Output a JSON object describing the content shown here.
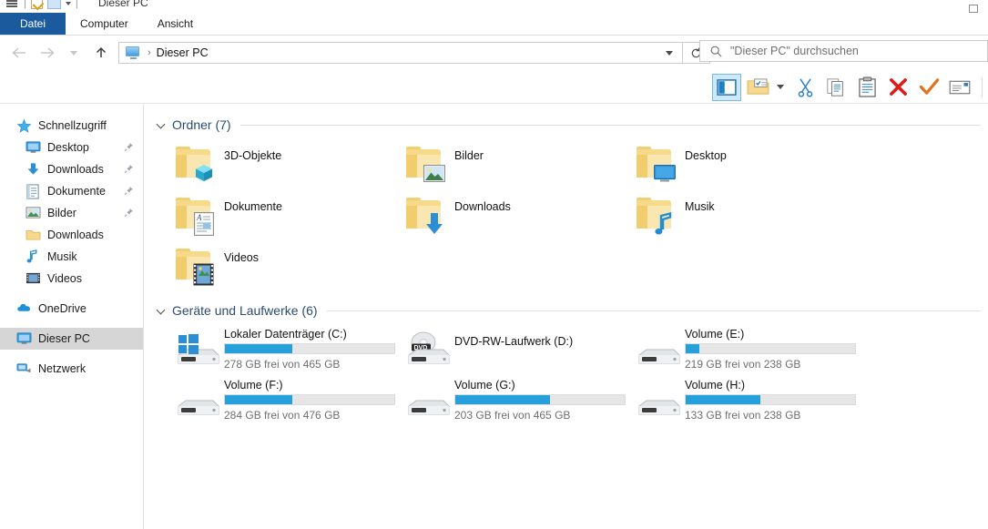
{
  "window": {
    "title": "Dieser PC",
    "quick_access_icons": [
      "menu-icon",
      "save-icon",
      "monitor-icon",
      "chevron-down-icon"
    ],
    "maximize_label": ""
  },
  "menubar": {
    "items": [
      {
        "label": "Datei",
        "active": true
      },
      {
        "label": "Computer",
        "active": false
      },
      {
        "label": "Ansicht",
        "active": false
      }
    ]
  },
  "addressbar": {
    "back_icon": "back-arrow-icon",
    "forward_icon": "forward-arrow-icon",
    "recent_icon": "recent-locations-icon",
    "up_icon": "up-arrow-icon",
    "path_icon": "this-pc-icon",
    "separator": "›",
    "path": "Dieser PC",
    "dropdown_icon": "chevron-down-icon",
    "refresh_icon": "refresh-icon"
  },
  "search": {
    "icon": "search-icon",
    "placeholder": "\"Dieser PC\" durchsuchen",
    "value": ""
  },
  "toolbar": {
    "buttons": [
      {
        "name": "navigation-pane-toggle",
        "icon": "layout-pane-icon",
        "selected": true
      },
      {
        "name": "new-folder-button",
        "icon": "new-folder-icon",
        "selected": false,
        "has_dropdown": true
      },
      {
        "name": "cut-button",
        "icon": "scissors-icon",
        "selected": false
      },
      {
        "name": "copy-button",
        "icon": "copy-icon",
        "selected": false
      },
      {
        "name": "paste-button",
        "icon": "clipboard-icon",
        "selected": false
      },
      {
        "name": "delete-button",
        "icon": "red-x-icon",
        "selected": false
      },
      {
        "name": "confirm-button",
        "icon": "checkmark-icon",
        "selected": false
      },
      {
        "name": "rename-button",
        "icon": "rename-icon",
        "selected": false
      }
    ]
  },
  "sidebar": {
    "items": [
      {
        "label": "Schnellzugriff",
        "icon": "star-icon",
        "indent": false,
        "pinned": false,
        "selected": false
      },
      {
        "label": "Desktop",
        "icon": "desktop-icon",
        "indent": true,
        "pinned": true,
        "selected": false
      },
      {
        "label": "Downloads",
        "icon": "download-arrow-icon",
        "indent": true,
        "pinned": true,
        "selected": false
      },
      {
        "label": "Dokumente",
        "icon": "document-icon",
        "indent": true,
        "pinned": true,
        "selected": false
      },
      {
        "label": "Bilder",
        "icon": "picture-icon",
        "indent": true,
        "pinned": true,
        "selected": false
      },
      {
        "label": "Downloads",
        "icon": "folder-icon",
        "indent": true,
        "pinned": false,
        "selected": false
      },
      {
        "label": "Musik",
        "icon": "music-note-icon",
        "indent": true,
        "pinned": false,
        "selected": false
      },
      {
        "label": "Videos",
        "icon": "film-icon",
        "indent": true,
        "pinned": false,
        "selected": false
      },
      {
        "label": "OneDrive",
        "icon": "cloud-icon",
        "indent": false,
        "pinned": false,
        "selected": false
      },
      {
        "label": "Dieser PC",
        "icon": "this-pc-icon",
        "indent": false,
        "pinned": false,
        "selected": true
      },
      {
        "label": "Netzwerk",
        "icon": "network-icon",
        "indent": false,
        "pinned": false,
        "selected": false
      }
    ]
  },
  "groups": {
    "folders": {
      "title": "Ordner (7)",
      "items": [
        {
          "label": "3D-Objekte",
          "icon": "folder-3d-objects-icon"
        },
        {
          "label": "Bilder",
          "icon": "folder-pictures-icon"
        },
        {
          "label": "Desktop",
          "icon": "folder-desktop-icon"
        },
        {
          "label": "Dokumente",
          "icon": "folder-documents-icon"
        },
        {
          "label": "Downloads",
          "icon": "folder-downloads-icon"
        },
        {
          "label": "Musik",
          "icon": "folder-music-icon"
        },
        {
          "label": "Videos",
          "icon": "folder-videos-icon"
        }
      ]
    },
    "drives": {
      "title": "Geräte und Laufwerke (6)",
      "items": [
        {
          "label": "Lokaler Datenträger (C:)",
          "icon": "windows-drive-icon",
          "has_bar": true,
          "free_gb": 278,
          "total_gb": 465,
          "used_percent": 40,
          "sub": "278 GB frei von 465 GB"
        },
        {
          "label": "DVD-RW-Laufwerk (D:)",
          "icon": "dvd-drive-icon",
          "has_bar": false,
          "sub": ""
        },
        {
          "label": "Volume (E:)",
          "icon": "hard-drive-icon",
          "has_bar": true,
          "free_gb": 219,
          "total_gb": 238,
          "used_percent": 8,
          "sub": "219 GB frei von 238 GB"
        },
        {
          "label": "Volume (F:)",
          "icon": "hard-drive-icon",
          "has_bar": true,
          "free_gb": 284,
          "total_gb": 476,
          "used_percent": 40,
          "sub": "284 GB frei von 476 GB"
        },
        {
          "label": "Volume (G:)",
          "icon": "hard-drive-icon",
          "has_bar": true,
          "free_gb": 203,
          "total_gb": 465,
          "used_percent": 56,
          "sub": "203 GB frei von 465 GB"
        },
        {
          "label": "Volume (H:)",
          "icon": "hard-drive-icon",
          "has_bar": true,
          "free_gb": 133,
          "total_gb": 238,
          "used_percent": 44,
          "sub": "133 GB frei von 238 GB"
        }
      ]
    }
  },
  "colors": {
    "accent_blue": "#26a0da",
    "menu_active_bg": "#1c5a9e",
    "group_header_text": "#2b4b6f",
    "selection_bg": "#d6d6d6",
    "bar_track": "#e6e6e6"
  }
}
